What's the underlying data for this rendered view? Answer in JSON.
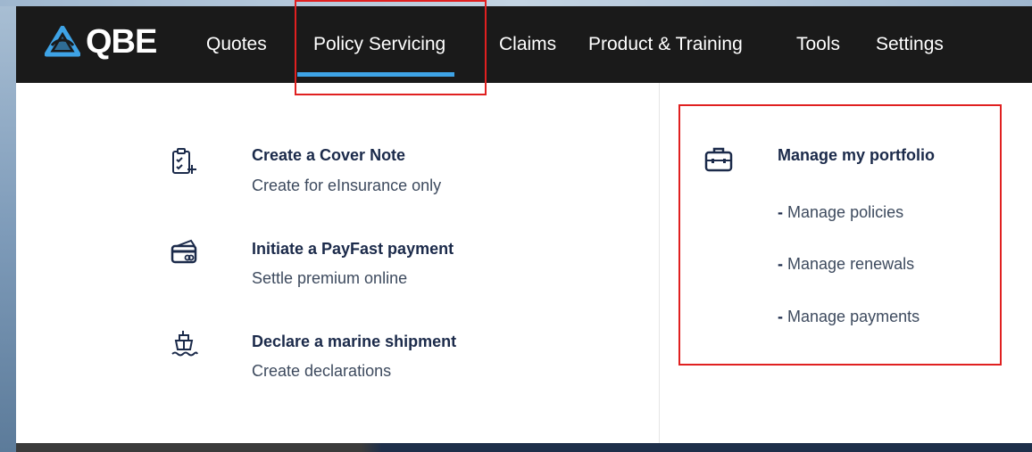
{
  "brand": {
    "name": "QBE",
    "color": "#1a1a1a",
    "accent": "#3ea3e6"
  },
  "nav": {
    "items": [
      {
        "label": "Quotes"
      },
      {
        "label": "Policy Servicing",
        "active": true
      },
      {
        "label": "Claims"
      },
      {
        "label": "Product & Training"
      },
      {
        "label": "Tools"
      },
      {
        "label": "Settings"
      }
    ]
  },
  "menu": {
    "left": [
      {
        "title": "Create a Cover Note",
        "subtitle": "Create for eInsurance only",
        "icon": "clipboard-add-icon"
      },
      {
        "title": "Initiate a PayFast payment",
        "subtitle": "Settle premium online",
        "icon": "credit-card-icon"
      },
      {
        "title": "Declare a marine shipment",
        "subtitle": "Create declarations",
        "icon": "ship-icon"
      }
    ],
    "right": {
      "title": "Manage my portfolio",
      "icon": "briefcase-icon",
      "links": [
        {
          "dash": "-",
          "label": "Manage policies"
        },
        {
          "dash": "-",
          "label": "Manage renewals"
        },
        {
          "dash": "-",
          "label": "Manage payments"
        }
      ]
    }
  },
  "annotations": {
    "highlight_color": "#e02020"
  }
}
